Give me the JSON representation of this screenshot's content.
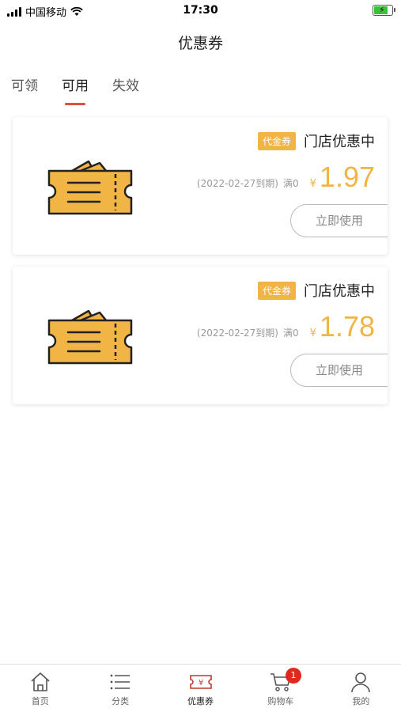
{
  "status_bar": {
    "carrier": "中国移动",
    "time": "17:30",
    "battery_level": 0.75
  },
  "header": {
    "title": "优惠券"
  },
  "tabs": [
    {
      "label": "可领"
    },
    {
      "label": "可用",
      "active": true
    },
    {
      "label": "失效"
    }
  ],
  "coupons": [
    {
      "badge": "代金券",
      "name": "门店优惠中",
      "expiry": "(2022-02-27到期)",
      "threshold": "满0",
      "currency": "¥",
      "amount": "1.97",
      "action": "立即使用"
    },
    {
      "badge": "代金券",
      "name": "门店优惠中",
      "expiry": "(2022-02-27到期)",
      "threshold": "满0",
      "currency": "¥",
      "amount": "1.78",
      "action": "立即使用"
    }
  ],
  "tabbar": {
    "items": [
      {
        "label": "首页",
        "icon": "home-icon"
      },
      {
        "label": "分类",
        "icon": "list-icon"
      },
      {
        "label": "优惠券",
        "icon": "coupon-icon",
        "active": true
      },
      {
        "label": "购物车",
        "icon": "cart-icon",
        "badge": "1"
      },
      {
        "label": "我的",
        "icon": "user-icon"
      }
    ]
  },
  "colors": {
    "accent": "#f0b545",
    "tab_indicator": "#d9503c",
    "badge_red": "#e0291d",
    "battery": "#3cc13b"
  }
}
